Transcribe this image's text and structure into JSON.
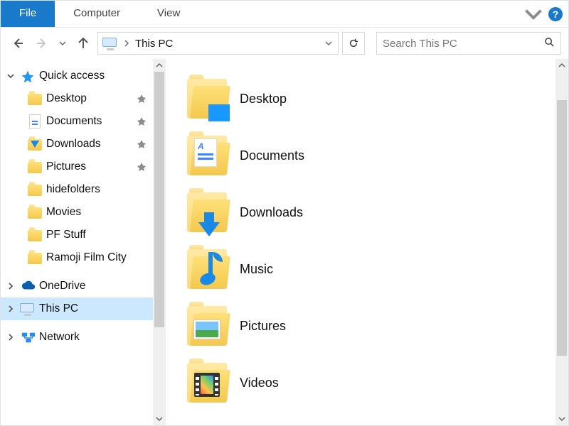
{
  "ribbon": {
    "file": "File",
    "computer": "Computer",
    "view": "View",
    "help": "?"
  },
  "address": {
    "location": "This PC"
  },
  "search": {
    "placeholder": "Search This PC"
  },
  "nav": {
    "quick_access": {
      "label": "Quick access"
    },
    "items": [
      {
        "label": "Desktop",
        "pinned": true,
        "icon": "desktop"
      },
      {
        "label": "Documents",
        "pinned": true,
        "icon": "documents"
      },
      {
        "label": "Downloads",
        "pinned": true,
        "icon": "downloads"
      },
      {
        "label": "Pictures",
        "pinned": true,
        "icon": "pictures"
      },
      {
        "label": "hidefolders",
        "pinned": false,
        "icon": "folder"
      },
      {
        "label": "Movies",
        "pinned": false,
        "icon": "folder"
      },
      {
        "label": "PF Stuff",
        "pinned": false,
        "icon": "folder"
      },
      {
        "label": "Ramoji Film City",
        "pinned": false,
        "icon": "folder"
      }
    ],
    "onedrive": "OneDrive",
    "thispc": "This PC",
    "network": "Network"
  },
  "content": {
    "folders": [
      {
        "label": "Desktop",
        "kind": "desktop"
      },
      {
        "label": "Documents",
        "kind": "documents"
      },
      {
        "label": "Downloads",
        "kind": "downloads"
      },
      {
        "label": "Music",
        "kind": "music"
      },
      {
        "label": "Pictures",
        "kind": "pictures"
      },
      {
        "label": "Videos",
        "kind": "videos"
      }
    ]
  }
}
